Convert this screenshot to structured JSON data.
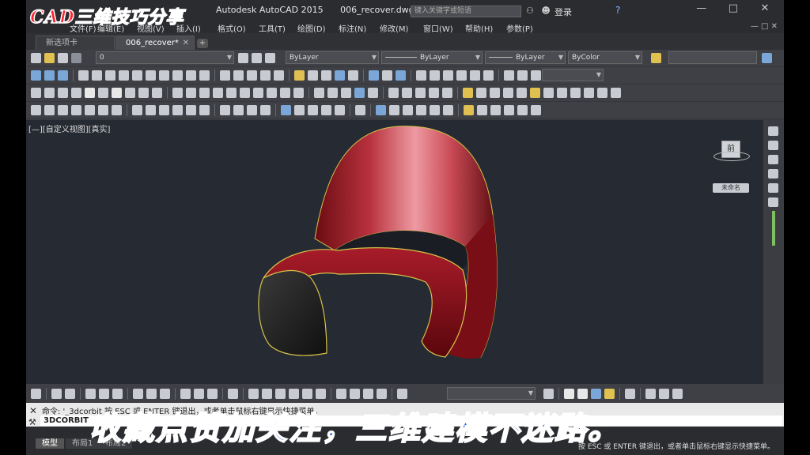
{
  "window": {
    "title_app": "Autodesk AutoCAD 2015",
    "title_file": "006_recover.dwg",
    "search_placeholder": "键入关键字或短语",
    "login": "登录",
    "help": "?"
  },
  "menu": [
    "文件(F)",
    "编辑(E)",
    "视图(V)",
    "插入(I)",
    "格式(O)",
    "工具(T)",
    "绘图(D)",
    "标注(N)",
    "修改(M)",
    "窗口(W)",
    "帮助(H)",
    "参数(P)"
  ],
  "tabs": [
    {
      "label": "新选项卡",
      "active": false
    },
    {
      "label": "006_recover*",
      "active": true
    }
  ],
  "properties": {
    "layer": "0",
    "color": "ByLayer",
    "linetype": "ByLayer",
    "lineweight": "ByLayer",
    "plotstyle": "ByColor"
  },
  "viewport": {
    "label": "[—][自定义视图][真实]",
    "viewcube_face": "前",
    "wcs": "未命名"
  },
  "command": {
    "history": "命令: '_3dcorbit  按 ESC 或 ENTER 键退出，或者单击鼠标右键显示快捷菜单。",
    "input": "3DCORBIT"
  },
  "layout_tabs": [
    {
      "label": "模型",
      "active": true
    },
    {
      "label": "布局1",
      "active": false
    },
    {
      "label": "布局2",
      "active": false
    }
  ],
  "status_hint": "按 ESC 或 ENTER 键退出，或者单击鼠标右键显示快捷菜单。",
  "overlay": {
    "top": "CAD三维技巧分享",
    "bottom": "收藏点赞加关注，三维建模不迷路。"
  }
}
